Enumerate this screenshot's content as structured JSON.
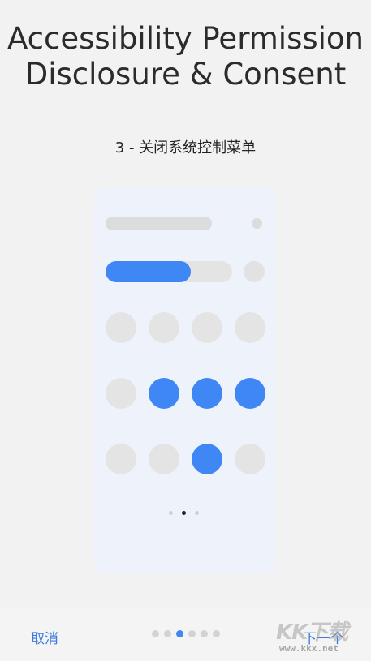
{
  "title": {
    "line1": "Accessibility Permission",
    "line2": "Disclosure & Consent"
  },
  "step_text": "3 - 关闭系统控制菜单",
  "illustration": {
    "slider_fill_percent": 67,
    "toggles": [
      [
        false,
        false,
        false,
        false
      ],
      [
        false,
        true,
        true,
        true
      ],
      [
        false,
        false,
        true,
        false
      ]
    ],
    "pager": {
      "count": 3,
      "active_index": 1
    },
    "accent_color": "#3f87f5"
  },
  "bottom_bar": {
    "cancel_label": "取消",
    "next_label": "下一个",
    "progress_dots": {
      "count": 6,
      "active_index": 2
    }
  },
  "watermark": {
    "logo": "KK下载",
    "url": "www.kkx.net"
  }
}
